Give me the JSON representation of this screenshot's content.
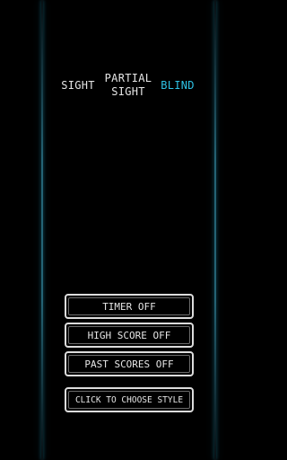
{
  "modes": {
    "items": [
      {
        "label": "SIGHT"
      },
      {
        "label": "PARTIAL SIGHT"
      },
      {
        "label": "BLIND"
      }
    ],
    "selected": "BLIND"
  },
  "options": {
    "timer": "TIMER OFF",
    "high_score": "HIGH SCORE OFF",
    "past_scores": "PAST SCORES OFF",
    "style": "CLICK TO CHOOSE STYLE"
  },
  "colors": {
    "background": "#000000",
    "text": "#e6e6e6",
    "active": "#2ec3e6",
    "edge_glow": "#28788c"
  }
}
